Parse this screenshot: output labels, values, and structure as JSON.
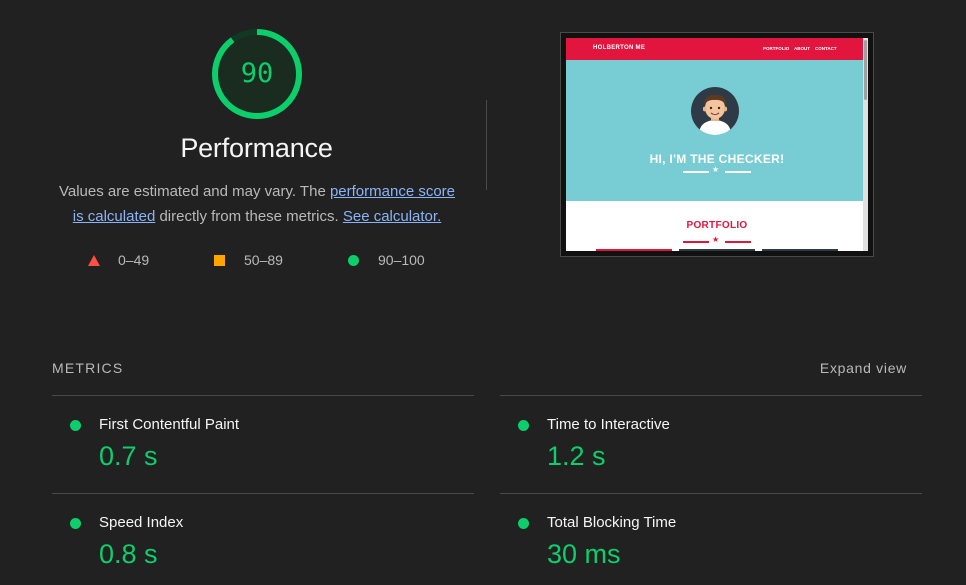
{
  "score": {
    "value": "90",
    "fraction": 0.9,
    "color": "#0cce6b"
  },
  "title": "Performance",
  "description": {
    "pre": "Values are estimated and may vary. The ",
    "link1_line1": "performance score",
    "link1_line2": "is calculated",
    "mid": " directly from these metrics. ",
    "link2": "See calculator."
  },
  "legend": [
    {
      "icon": "triangle-icon",
      "label": "0–49",
      "color": "#ff4e42"
    },
    {
      "icon": "square-icon",
      "label": "50–89",
      "color": "#ffa400"
    },
    {
      "icon": "circle-icon",
      "label": "90–100",
      "color": "#0cce6b"
    }
  ],
  "screenshot": {
    "brand": "HOLBERTON ME",
    "nav": [
      "PORTFOLIO",
      "ABOUT",
      "CONTACT"
    ],
    "hero_text": "HI, I'M THE CHECKER!",
    "section_title": "PORTFOLIO"
  },
  "metrics": {
    "heading": "METRICS",
    "expand_label": "Expand view",
    "items": [
      {
        "label": "First Contentful Paint",
        "value": "0.7 s",
        "status": "pass"
      },
      {
        "label": "Time to Interactive",
        "value": "1.2 s",
        "status": "pass"
      },
      {
        "label": "Speed Index",
        "value": "0.8 s",
        "status": "pass"
      },
      {
        "label": "Total Blocking Time",
        "value": "30 ms",
        "status": "pass"
      }
    ]
  }
}
